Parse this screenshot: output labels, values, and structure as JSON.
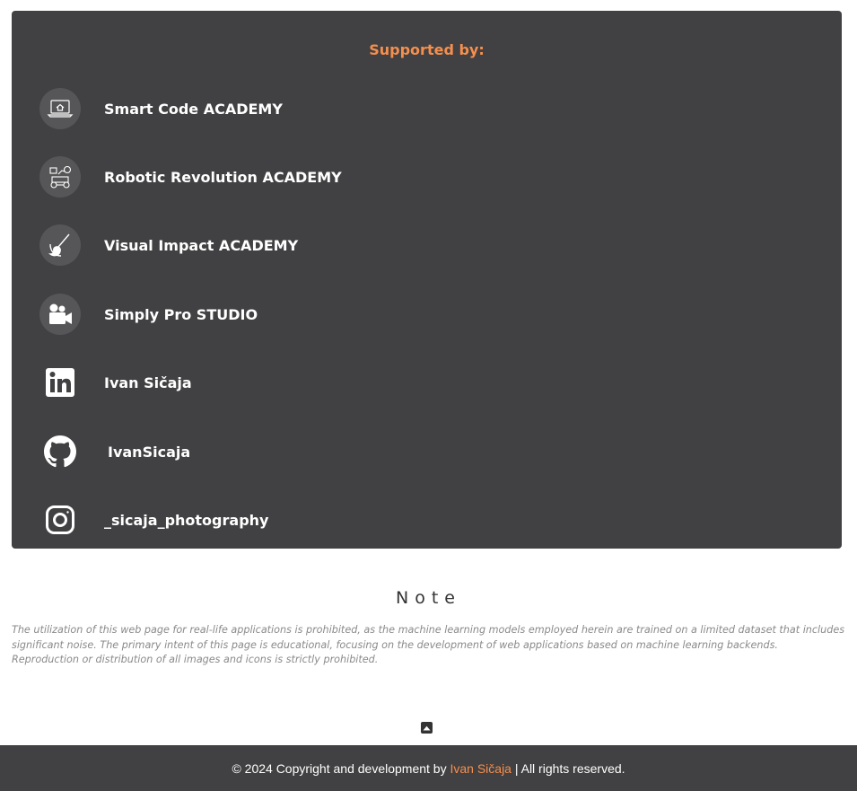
{
  "supported": {
    "title": "Supported by:",
    "items": [
      {
        "label": "Smart Code ACADEMY",
        "icon": "laptop-home-icon"
      },
      {
        "label": "Robotic Revolution ACADEMY",
        "icon": "robot-icon"
      },
      {
        "label": "Visual Impact ACADEMY",
        "icon": "brush-icon"
      },
      {
        "label": "Simply Pro STUDIO",
        "icon": "video-camera-icon"
      },
      {
        "label": "Ivan Sičaja",
        "icon": "linkedin-icon"
      },
      {
        "label": "IvanSicaja",
        "icon": "github-icon"
      },
      {
        "label": "_sicaja_photography",
        "icon": "instagram-icon"
      }
    ]
  },
  "note": {
    "title": "Note",
    "text": "The utilization of this web page for real-life applications is prohibited, as the machine learning models employed herein are trained on a limited dataset that includes significant noise. The primary intent of this page is educational, focusing on the development of web applications based on machine learning backends. Reproduction or distribution of all images and icons is strictly prohibited."
  },
  "footer": {
    "copyright": "© 2024 Copyright and development by ",
    "name": "Ivan Sičaja",
    "rights": " | All rights reserved."
  },
  "colors": {
    "panel_bg": "#414042",
    "accent": "#f58f4e",
    "icon_circle": "#565557"
  }
}
